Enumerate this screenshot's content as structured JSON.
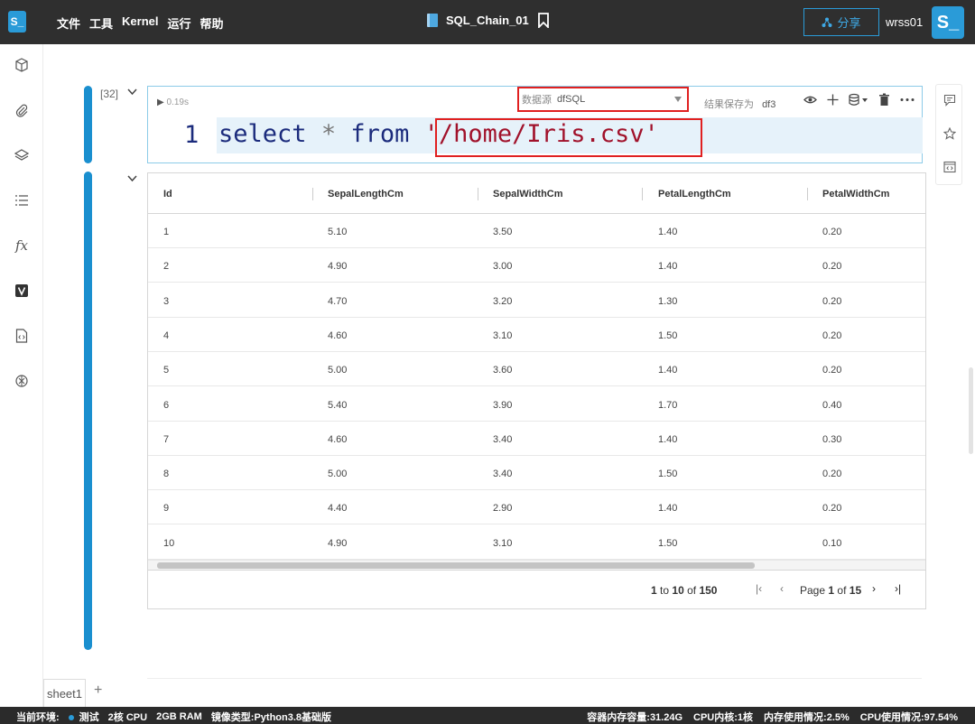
{
  "app": {
    "logo": "S_"
  },
  "menu": [
    "文件",
    "工具",
    "Kernel",
    "运行",
    "帮助"
  ],
  "doc": {
    "title": "SQL_Chain_01"
  },
  "header": {
    "share_label": "分享",
    "user": "wrss01",
    "avatar": "S_"
  },
  "sidebar_icons": [
    "cube-icon",
    "paperclip-icon",
    "layers-icon",
    "list-icon",
    "function-icon",
    "v-icon",
    "code-file-icon",
    "openai-icon"
  ],
  "cell": {
    "exec_count": "[32]",
    "run_time": "0.19s",
    "datasource_label": "数据源",
    "datasource_value": "dfSQL",
    "save_label": "结果保存为",
    "save_value": "df3",
    "line_number": "1",
    "code_select": "select",
    "code_star": "*",
    "code_from": "from",
    "code_string": "'/home/Iris.csv'"
  },
  "table": {
    "columns": [
      "Id",
      "SepalLengthCm",
      "SepalWidthCm",
      "PetalLengthCm",
      "PetalWidthCm"
    ],
    "rows": [
      [
        "1",
        "5.10",
        "3.50",
        "1.40",
        "0.20"
      ],
      [
        "2",
        "4.90",
        "3.00",
        "1.40",
        "0.20"
      ],
      [
        "3",
        "4.70",
        "3.20",
        "1.30",
        "0.20"
      ],
      [
        "4",
        "4.60",
        "3.10",
        "1.50",
        "0.20"
      ],
      [
        "5",
        "5.00",
        "3.60",
        "1.40",
        "0.20"
      ],
      [
        "6",
        "5.40",
        "3.90",
        "1.70",
        "0.40"
      ],
      [
        "7",
        "4.60",
        "3.40",
        "1.40",
        "0.30"
      ],
      [
        "8",
        "5.00",
        "3.40",
        "1.50",
        "0.20"
      ],
      [
        "9",
        "4.40",
        "2.90",
        "1.40",
        "0.20"
      ],
      [
        "10",
        "4.90",
        "3.10",
        "1.50",
        "0.10"
      ]
    ]
  },
  "pager": {
    "range_from": "1",
    "to_text": "to",
    "range_to": "10",
    "of_text": "of",
    "total": "150",
    "page_text": "Page",
    "page": "1",
    "of_text2": "of",
    "pages": "15"
  },
  "sheet": {
    "tab": "sheet1",
    "add": "+"
  },
  "status": {
    "env_label": "当前环境:",
    "env_value": "测试",
    "cpu": "2核 CPU",
    "ram": "2GB RAM",
    "image": "镜像类型:Python3.8基础版",
    "container_mem": "容器内存容量:31.24G",
    "cpu_cores": "CPU内核:1核",
    "mem_usage": "内存使用情况:2.5%",
    "cpu_usage": "CPU使用情况:97.54%"
  },
  "colors": {
    "accent": "#1a8fcf",
    "highlight_red": "#e02020",
    "topbar": "#2f2f2f"
  }
}
